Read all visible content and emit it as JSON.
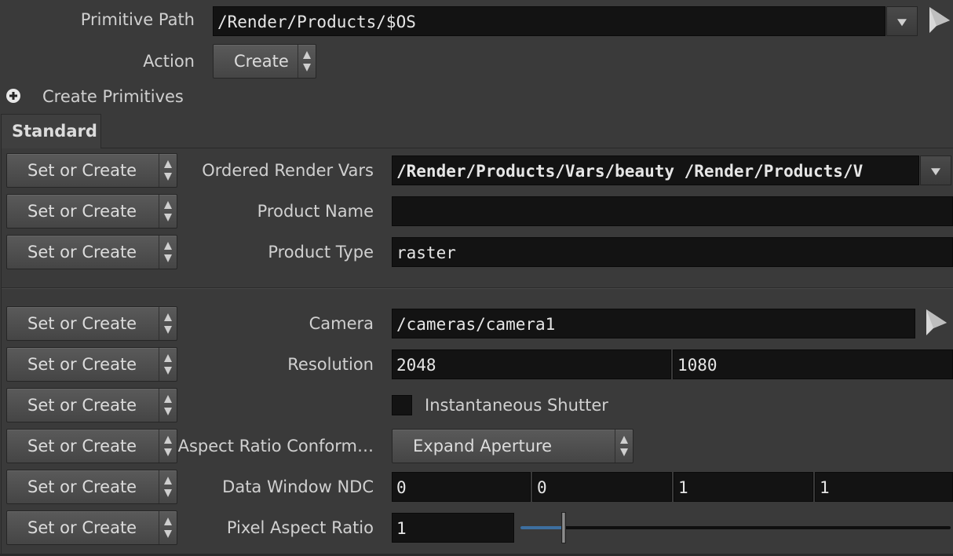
{
  "header": {
    "primitive_path_label": "Primitive Path",
    "primitive_path_value": "/Render/Products/$OS",
    "action_label": "Action",
    "action_value": "Create",
    "create_primitives_label": "Create Primitives"
  },
  "tabs": [
    {
      "label": "Standard"
    }
  ],
  "rows": [
    {
      "mode": "Set or Create",
      "label": "Ordered Render Vars",
      "value": "/Render/Products/Vars/beauty /Render/Products/V"
    },
    {
      "mode": "Set or Create",
      "label": "Product Name",
      "value": ""
    },
    {
      "mode": "Set or Create",
      "label": "Product Type",
      "value": "raster"
    },
    {
      "mode": "Set or Create",
      "label": "Camera",
      "value": "/cameras/camera1"
    },
    {
      "mode": "Set or Create",
      "label": "Resolution",
      "values": [
        "2048",
        "1080"
      ]
    },
    {
      "mode": "Set or Create",
      "label": "",
      "checkbox_label": "Instantaneous Shutter",
      "checked": false
    },
    {
      "mode": "Set or Create",
      "label": "Aspect Ratio Conform…",
      "value": "Expand Aperture"
    },
    {
      "mode": "Set or Create",
      "label": "Data Window NDC",
      "values": [
        "0",
        "0",
        "1",
        "1"
      ]
    },
    {
      "mode": "Set or Create",
      "label": "Pixel Aspect Ratio",
      "value": "1",
      "slider_fraction": 0.1
    }
  ],
  "colors": {
    "background": "#3a3a3a",
    "field": "#131313",
    "slider_fill": "#3d6fa0"
  }
}
